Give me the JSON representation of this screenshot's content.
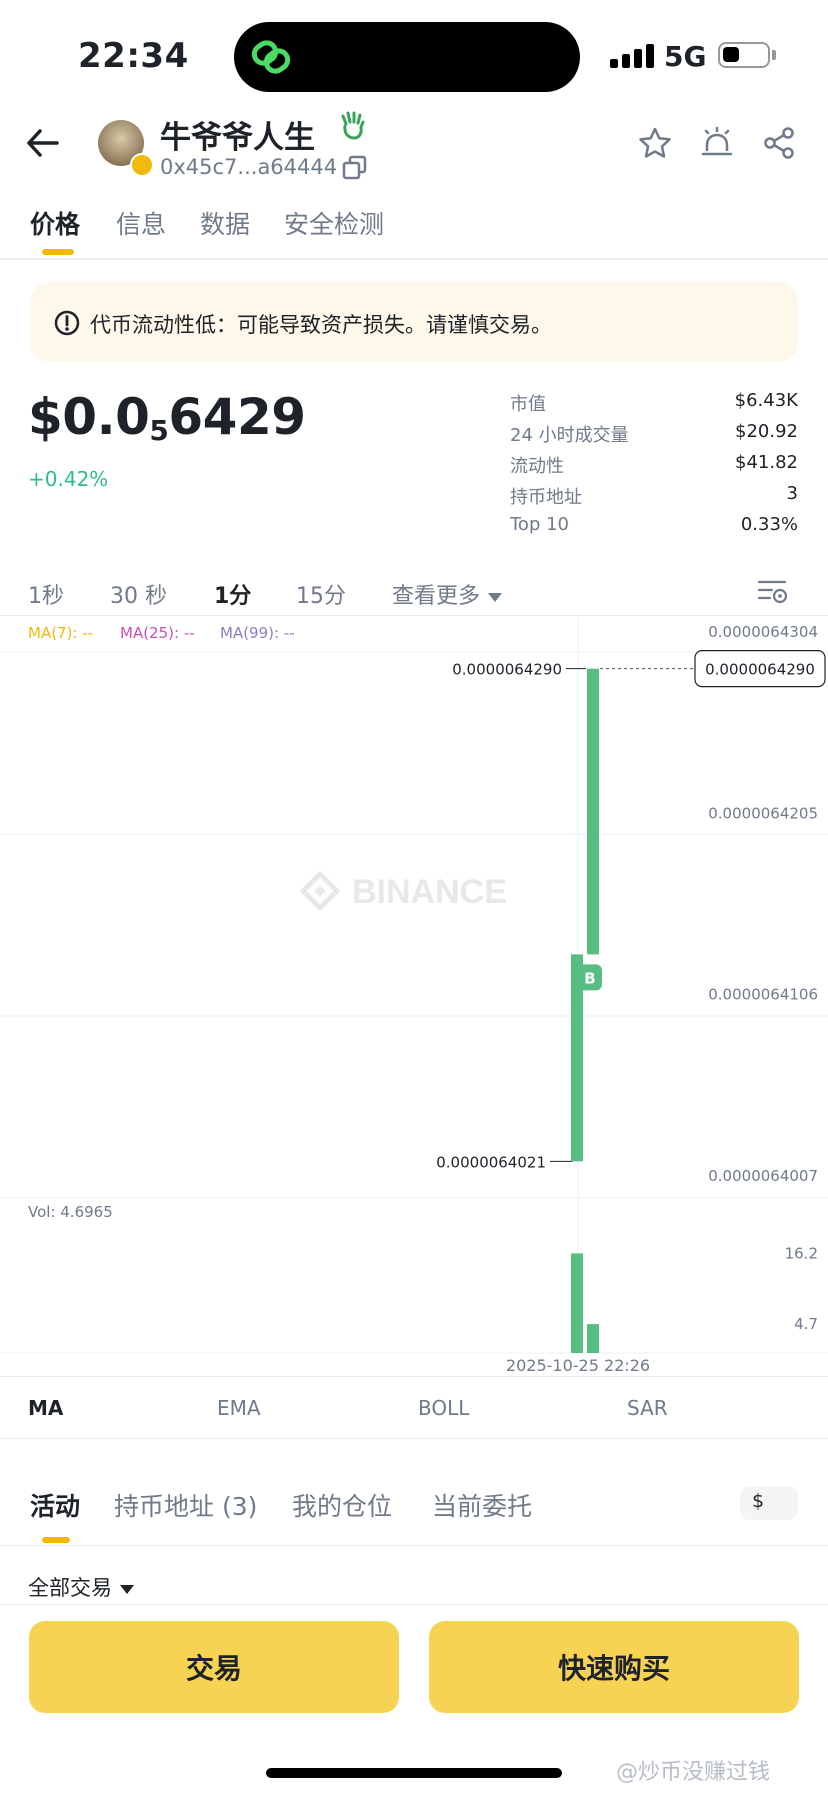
{
  "status_bar": {
    "time": "22:34",
    "network": "5G"
  },
  "header": {
    "token_name": "牛爷爷人生",
    "address": "0x45c7...a64444"
  },
  "tabs": [
    {
      "label": "价格"
    },
    {
      "label": "信息"
    },
    {
      "label": "数据"
    },
    {
      "label": "安全检测"
    }
  ],
  "warning": {
    "text": "代币流动性低：可能导致资产损失。请谨慎交易。"
  },
  "price": {
    "prefix": "$0.0",
    "zeros": "5",
    "digits": "6429",
    "change": "+0.42%"
  },
  "stats": [
    {
      "label": "市值",
      "value": "$6.43K"
    },
    {
      "label": "24 小时成交量",
      "value": "$20.92"
    },
    {
      "label": "流动性",
      "value": "$41.82"
    },
    {
      "label": "持币地址",
      "value": "3"
    },
    {
      "label": "Top 10",
      "value": "0.33%"
    }
  ],
  "intervals": [
    {
      "label": "1秒"
    },
    {
      "label": "30 秒"
    },
    {
      "label": "1分"
    },
    {
      "label": "15分"
    },
    {
      "label": "查看更多"
    }
  ],
  "ma_labels": [
    {
      "text": "MA(7): --",
      "color": "#f0b90b"
    },
    {
      "text": "MA(25): --",
      "color": "#cc4fb7"
    },
    {
      "text": "MA(99): --",
      "color": "#8e7cc3"
    }
  ],
  "watermark_brand": "BINANCE",
  "chart_data": {
    "type": "candlestick",
    "price_axis": [
      "0.0000064304",
      "0.0000064205",
      "0.0000064106",
      "0.0000064007"
    ],
    "y_range": [
      6.4007e-06,
      6.4304e-06
    ],
    "high_label": "0.0000064290",
    "low_label": "0.0000064021",
    "current_price_label": "0.0000064290",
    "candles": [
      {
        "open": 6.4021e-06,
        "close": 6.4134e-06,
        "high": 6.4134e-06,
        "low": 6.4021e-06,
        "volume": 16.2,
        "marker": "B"
      },
      {
        "open": 6.4134e-06,
        "close": 6.429e-06,
        "high": 6.429e-06,
        "low": 6.4134e-06,
        "volume": 4.7
      }
    ],
    "volume_label": "Vol: 4.6965",
    "volume_axis": [
      "16.2",
      "4.7"
    ],
    "volume_range": [
      0,
      20
    ],
    "time_label": "2025-10-25 22:26",
    "up_color": "#58bd83"
  },
  "indicators": [
    {
      "label": "MA"
    },
    {
      "label": "EMA"
    },
    {
      "label": "BOLL"
    },
    {
      "label": "SAR"
    }
  ],
  "lower_tabs": [
    {
      "label": "活动"
    },
    {
      "label": "持币地址 (3)"
    },
    {
      "label": "我的仓位"
    },
    {
      "label": "当前委托"
    }
  ],
  "currency": "$",
  "filter": {
    "label": "全部交易"
  },
  "buttons": {
    "trade": "交易",
    "quick_buy": "快速购买"
  },
  "footer_watermark": "@炒币没赚过钱"
}
